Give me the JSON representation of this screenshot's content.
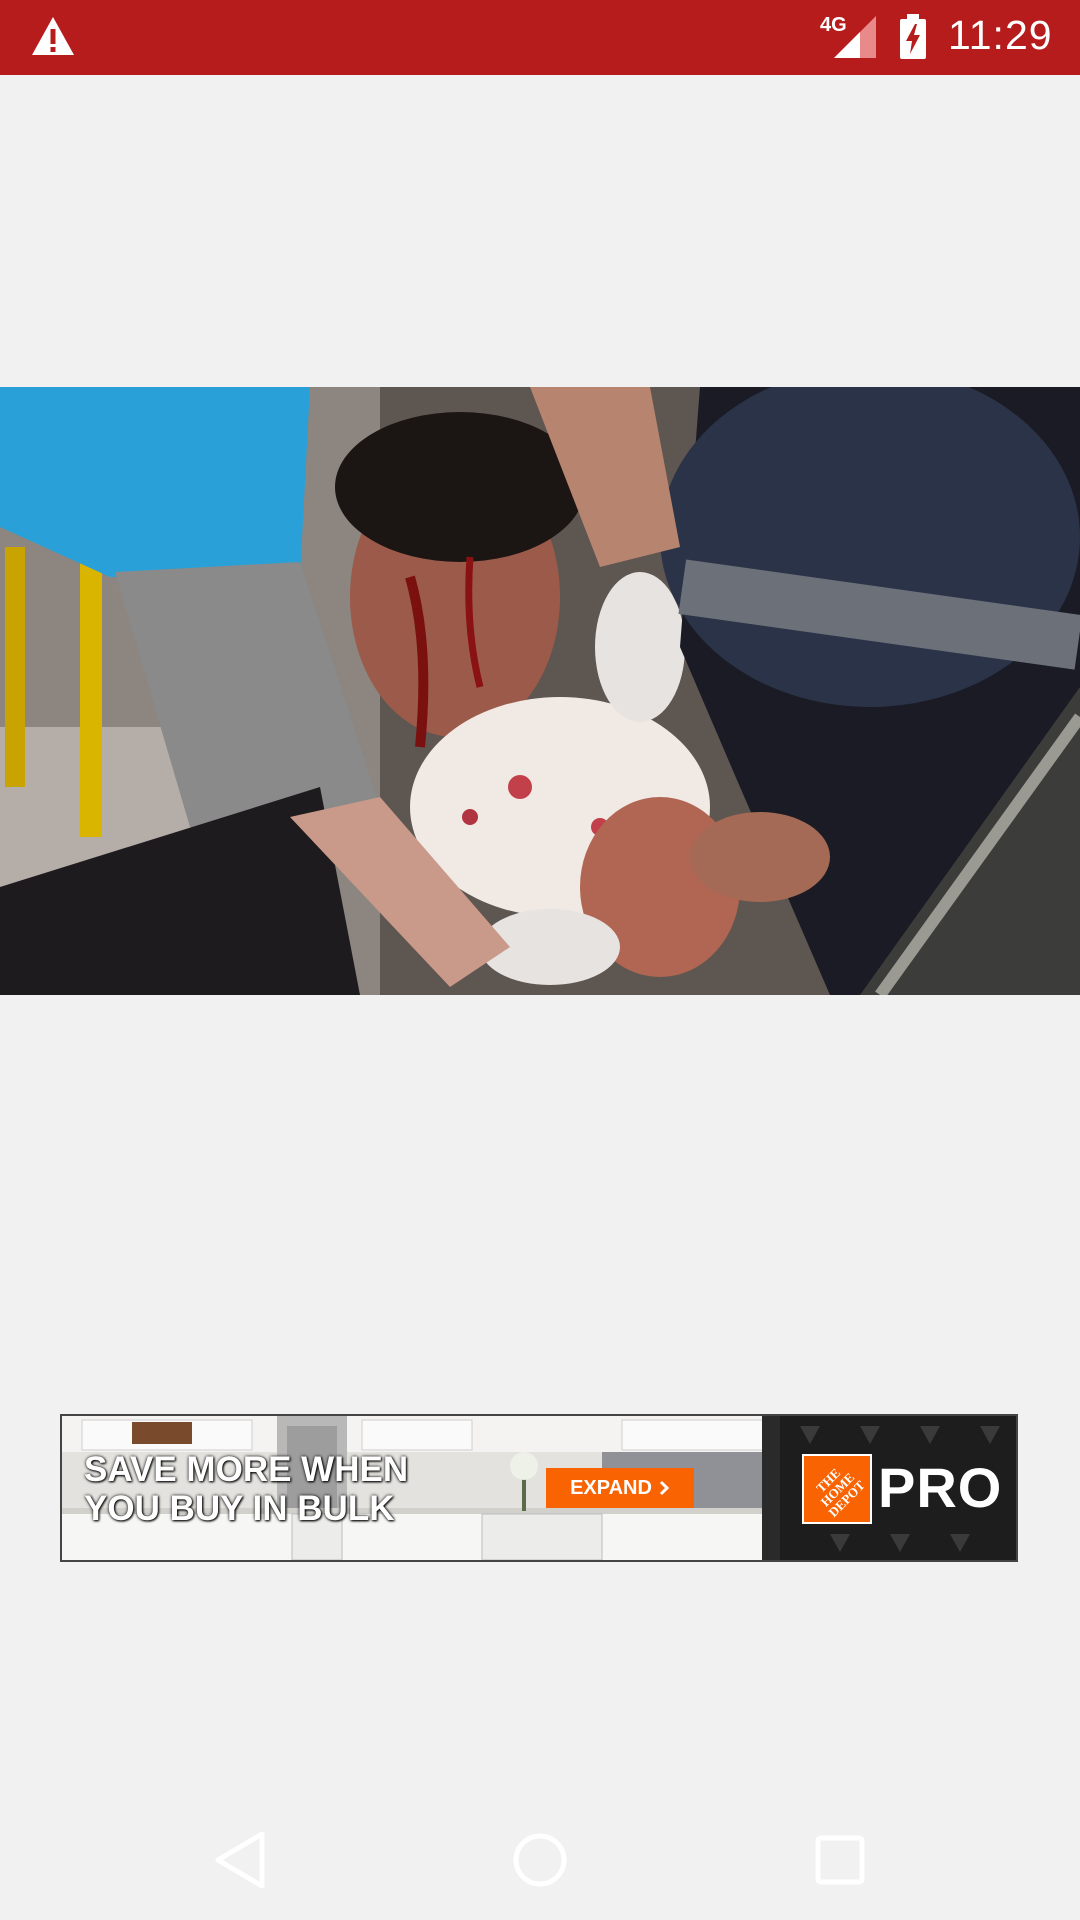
{
  "status_bar": {
    "time": "11:29",
    "network": "4G",
    "icons": [
      "warning-icon",
      "signal-icon",
      "battery-charging-icon"
    ],
    "color": "#b71c1c"
  },
  "article": {
    "photo": "photo"
  },
  "ad": {
    "headline": "SAVE MORE WHEN\nYOU BUY IN BULK",
    "button_label": "EXPAND",
    "button_icon": "chevron-right-icon",
    "logo_text": "THE\nHOME\nDEPOT",
    "brand_suffix": "PRO",
    "accent_color": "#f96302"
  },
  "nav_bar": {
    "buttons": [
      "back-icon",
      "home-icon",
      "recents-icon"
    ]
  }
}
